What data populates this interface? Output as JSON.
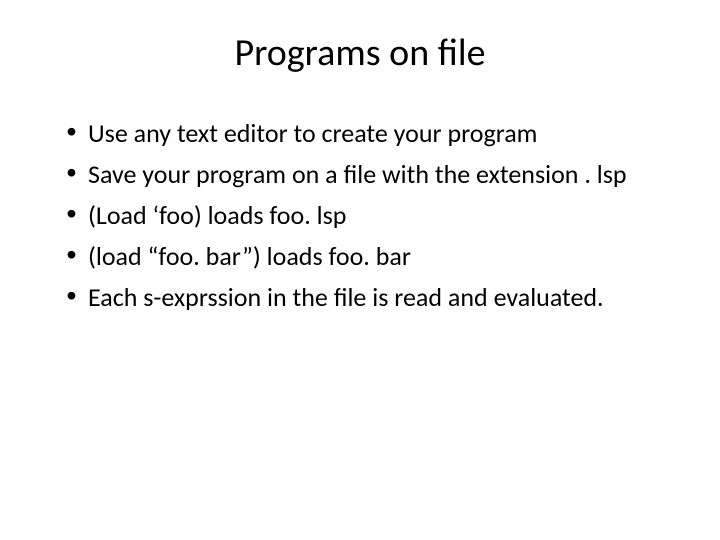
{
  "slide": {
    "title": "Programs on file",
    "bullets": [
      "Use any text editor to create your program",
      "Save your program on a file with the extension . lsp",
      "(Load ‘foo) loads foo. lsp",
      "(load “foo. bar”) loads foo. bar",
      "Each s-exprssion in the file is read and evaluated."
    ]
  }
}
